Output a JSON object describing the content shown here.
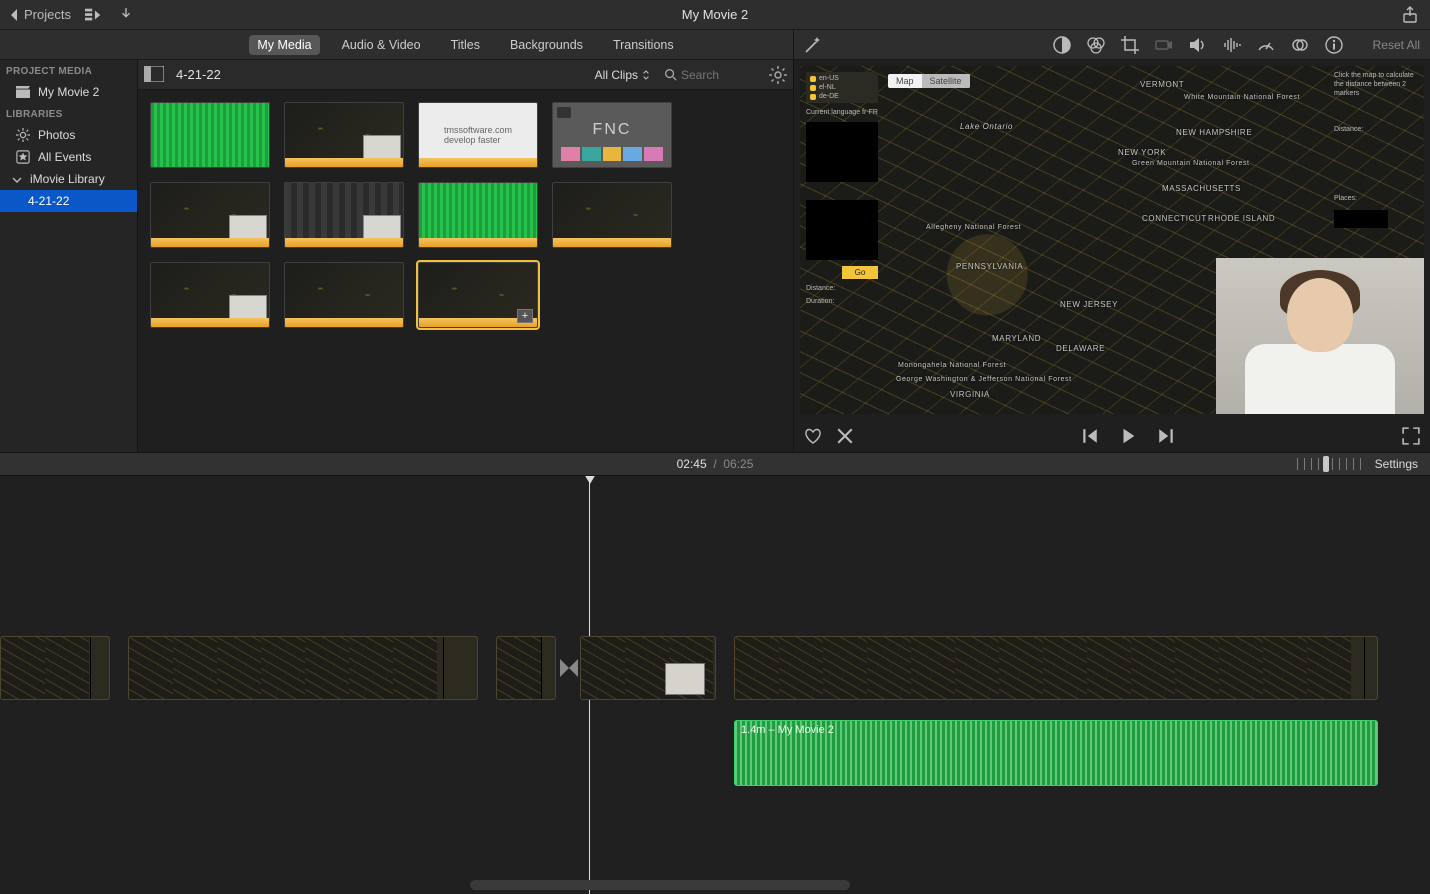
{
  "titlebar": {
    "back_label": "Projects",
    "movie_title": "My Movie 2"
  },
  "sidebar": {
    "project_media_header": "PROJECT MEDIA",
    "project_name": "My Movie 2",
    "libraries_header": "LIBRARIES",
    "photos": "Photos",
    "all_events": "All Events",
    "imovie_library": "iMovie Library",
    "selected_event": "4-21-22"
  },
  "media_tabs": {
    "my_media": "My Media",
    "audio_video": "Audio & Video",
    "titles": "Titles",
    "backgrounds": "Backgrounds",
    "transitions": "Transitions"
  },
  "media_header": {
    "event_name": "4-21-22",
    "filter": "All Clips",
    "search_placeholder": "Search"
  },
  "viewer_toolbar": {
    "reset_label": "Reset All"
  },
  "viewer_map": {
    "map_tab": "Map",
    "satellite_tab": "Satellite",
    "help_line1": "Click the map to calculate the distance between 2 markers",
    "help_distance": "Distance:",
    "help_places": "Places:",
    "lang_en": "en-US",
    "lang_el": "el-NL",
    "lang_de": "de-DE",
    "left_caption": "Current language fr-FR",
    "go_label": "Go",
    "footer_distance": "Distance:",
    "footer_duration": "Duration:",
    "labels": {
      "vermont": "VERMONT",
      "wmf": "White Mountain National Forest",
      "nh": "NEW HAMPSHIRE",
      "gmf": "Green Mountain National Forest",
      "ny": "NEW YORK",
      "ma": "MASSACHUSETTS",
      "ct": "CONNECTICUT",
      "ri": "RHODE ISLAND",
      "pa": "PENNSYLVANIA",
      "anf": "Allegheny National Forest",
      "nj": "NEW JERSEY",
      "md": "MARYLAND",
      "de": "DELAWARE",
      "mnf": "Monongahela National Forest",
      "va": "VIRGINIA",
      "gwf": "George Washington & Jefferson National Forest",
      "lake": "Lake Ontario"
    }
  },
  "timecode": {
    "current": "02:45",
    "total": "06:25",
    "settings": "Settings"
  },
  "clips": {
    "selected_duration": "1.4m"
  },
  "timeline": {
    "detached_audio_label": "1.4m – My Movie 2"
  }
}
